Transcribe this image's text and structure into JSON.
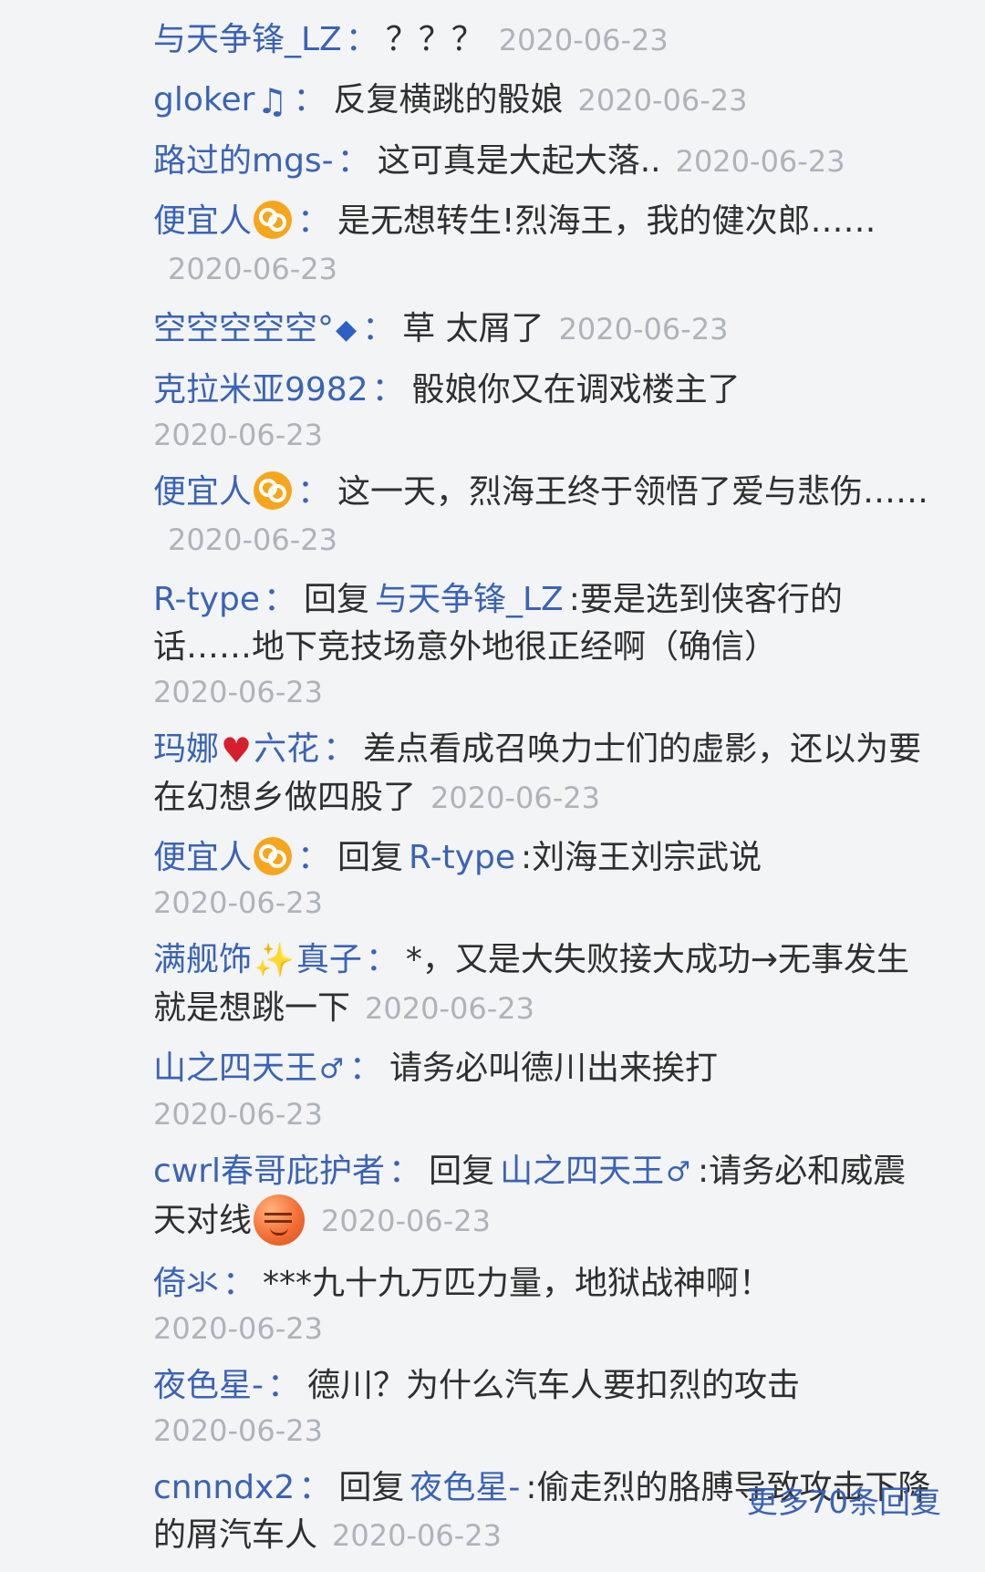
{
  "replies": [
    {
      "user": "与天争锋_LZ",
      "text": "？？？",
      "time": "2020-06-23"
    },
    {
      "user": "gloker",
      "icon": "music-note-icon",
      "text": "反复横跳的骰娘",
      "time": "2020-06-23"
    },
    {
      "user": "路过的mgs-",
      "text": "这可真是大起大落..",
      "time": "2020-06-23"
    },
    {
      "user": "便宜人",
      "icon": "cancer-zodiac-icon",
      "text": "是无想转生!烈海王，我的健次郎……",
      "time": "2020-06-23"
    },
    {
      "user": "空空空空空°",
      "icon": "blue-diamond-icon",
      "text": "草 太屑了",
      "time": "2020-06-23"
    },
    {
      "user": "克拉米亚9982",
      "text": "骰娘你又在调戏楼主了",
      "time": "2020-06-23"
    },
    {
      "user": "便宜人",
      "icon": "cancer-zodiac-icon",
      "text": "这一天，烈海王终于领悟了爱与悲伤……",
      "time": "2020-06-23"
    },
    {
      "user": "R-type",
      "reply_label": "回复",
      "reply_to": "与天争锋_LZ",
      "text": ":要是选到侠客行的话……地下竞技场意外地很正经啊（确信）",
      "time": "2020-06-23"
    },
    {
      "user_prefix": "玛娜",
      "icon": "heart-arrow-icon",
      "user_suffix": "六花",
      "text": "差点看成召唤力士们的虚影，还以为要在幻想乡做四股了",
      "time": "2020-06-23"
    },
    {
      "user": "便宜人",
      "icon": "cancer-zodiac-icon",
      "reply_label": "回复",
      "reply_to": "R-type",
      "text": ":刘海王刘宗武说",
      "time": "2020-06-23"
    },
    {
      "user_prefix": "满舰饰",
      "icon": "sparkle-icon",
      "user_suffix": "真子",
      "text": "*，又是大失败接大成功→无事发生就是想跳一下",
      "time": "2020-06-23"
    },
    {
      "user": "山之四天王",
      "icon": "male-symbol-icon",
      "text": "请务必叫德川出来挨打",
      "time": "2020-06-23"
    },
    {
      "user": "cwrl春哥庇护者",
      "reply_label": "回复",
      "reply_to": "山之四天王",
      "reply_to_icon": "male-symbol-icon",
      "text": ":请务必和威震天对线",
      "emoji": "smug-face-emoji-icon",
      "time": "2020-06-23"
    },
    {
      "user": "倚氺",
      "text": "***九十九万匹力量，地狱战神啊！",
      "time": "2020-06-23"
    },
    {
      "user": "夜色星-",
      "text": "德川？为什么汽车人要扣烈的攻击",
      "time": "2020-06-23"
    },
    {
      "user": "cnnndx2",
      "reply_label": "回复",
      "reply_to": "夜色星-",
      "text": ":偷走烈的胳膊导致攻击下降的屑汽车人",
      "time": "2020-06-23"
    }
  ],
  "colon": "：",
  "glyphs": {
    "music_note": "♫",
    "diamond": "◆",
    "heart": "♥",
    "sparkle": "✨",
    "male": "♂"
  },
  "more_replies": "更多70条回复",
  "colors": {
    "username": "#3a63b5",
    "text": "#2f2f2f",
    "timestamp": "#aeb3ba",
    "background": "#f3f4f6"
  }
}
